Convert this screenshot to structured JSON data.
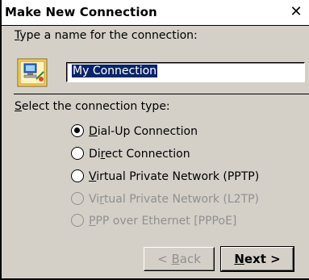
{
  "dialog": {
    "title": "Make New Connection",
    "close_glyph": "✕"
  },
  "name_section": {
    "label_access": "T",
    "label_rest": "ype a name for the connection:",
    "icon": "network-connection-icon",
    "input_value": "My Connection"
  },
  "type_section": {
    "label_access": "S",
    "label_rest": "elect the connection type:",
    "options": [
      {
        "pre": "",
        "access": "D",
        "rest": "ial-Up Connection",
        "selected": true,
        "enabled": true
      },
      {
        "pre": "Di",
        "access": "r",
        "rest": "ect Connection",
        "selected": false,
        "enabled": true
      },
      {
        "pre": "",
        "access": "V",
        "rest": "irtual Private Network (PPTP)",
        "selected": false,
        "enabled": true
      },
      {
        "pre": "Vi",
        "access": "r",
        "rest": "tual Private Network (L2TP)",
        "selected": false,
        "enabled": false
      },
      {
        "pre": "",
        "access": "P",
        "rest": "PP over Ethernet [PPPoE]",
        "selected": false,
        "enabled": false
      }
    ]
  },
  "buttons": {
    "back_pre": "< ",
    "back_access": "B",
    "back_rest": "ack",
    "next_access": "N",
    "next_rest": "ext >"
  },
  "colors": {
    "face": "#d4d0c8",
    "selection": "#0a246a",
    "disabled_text": "#909090"
  }
}
